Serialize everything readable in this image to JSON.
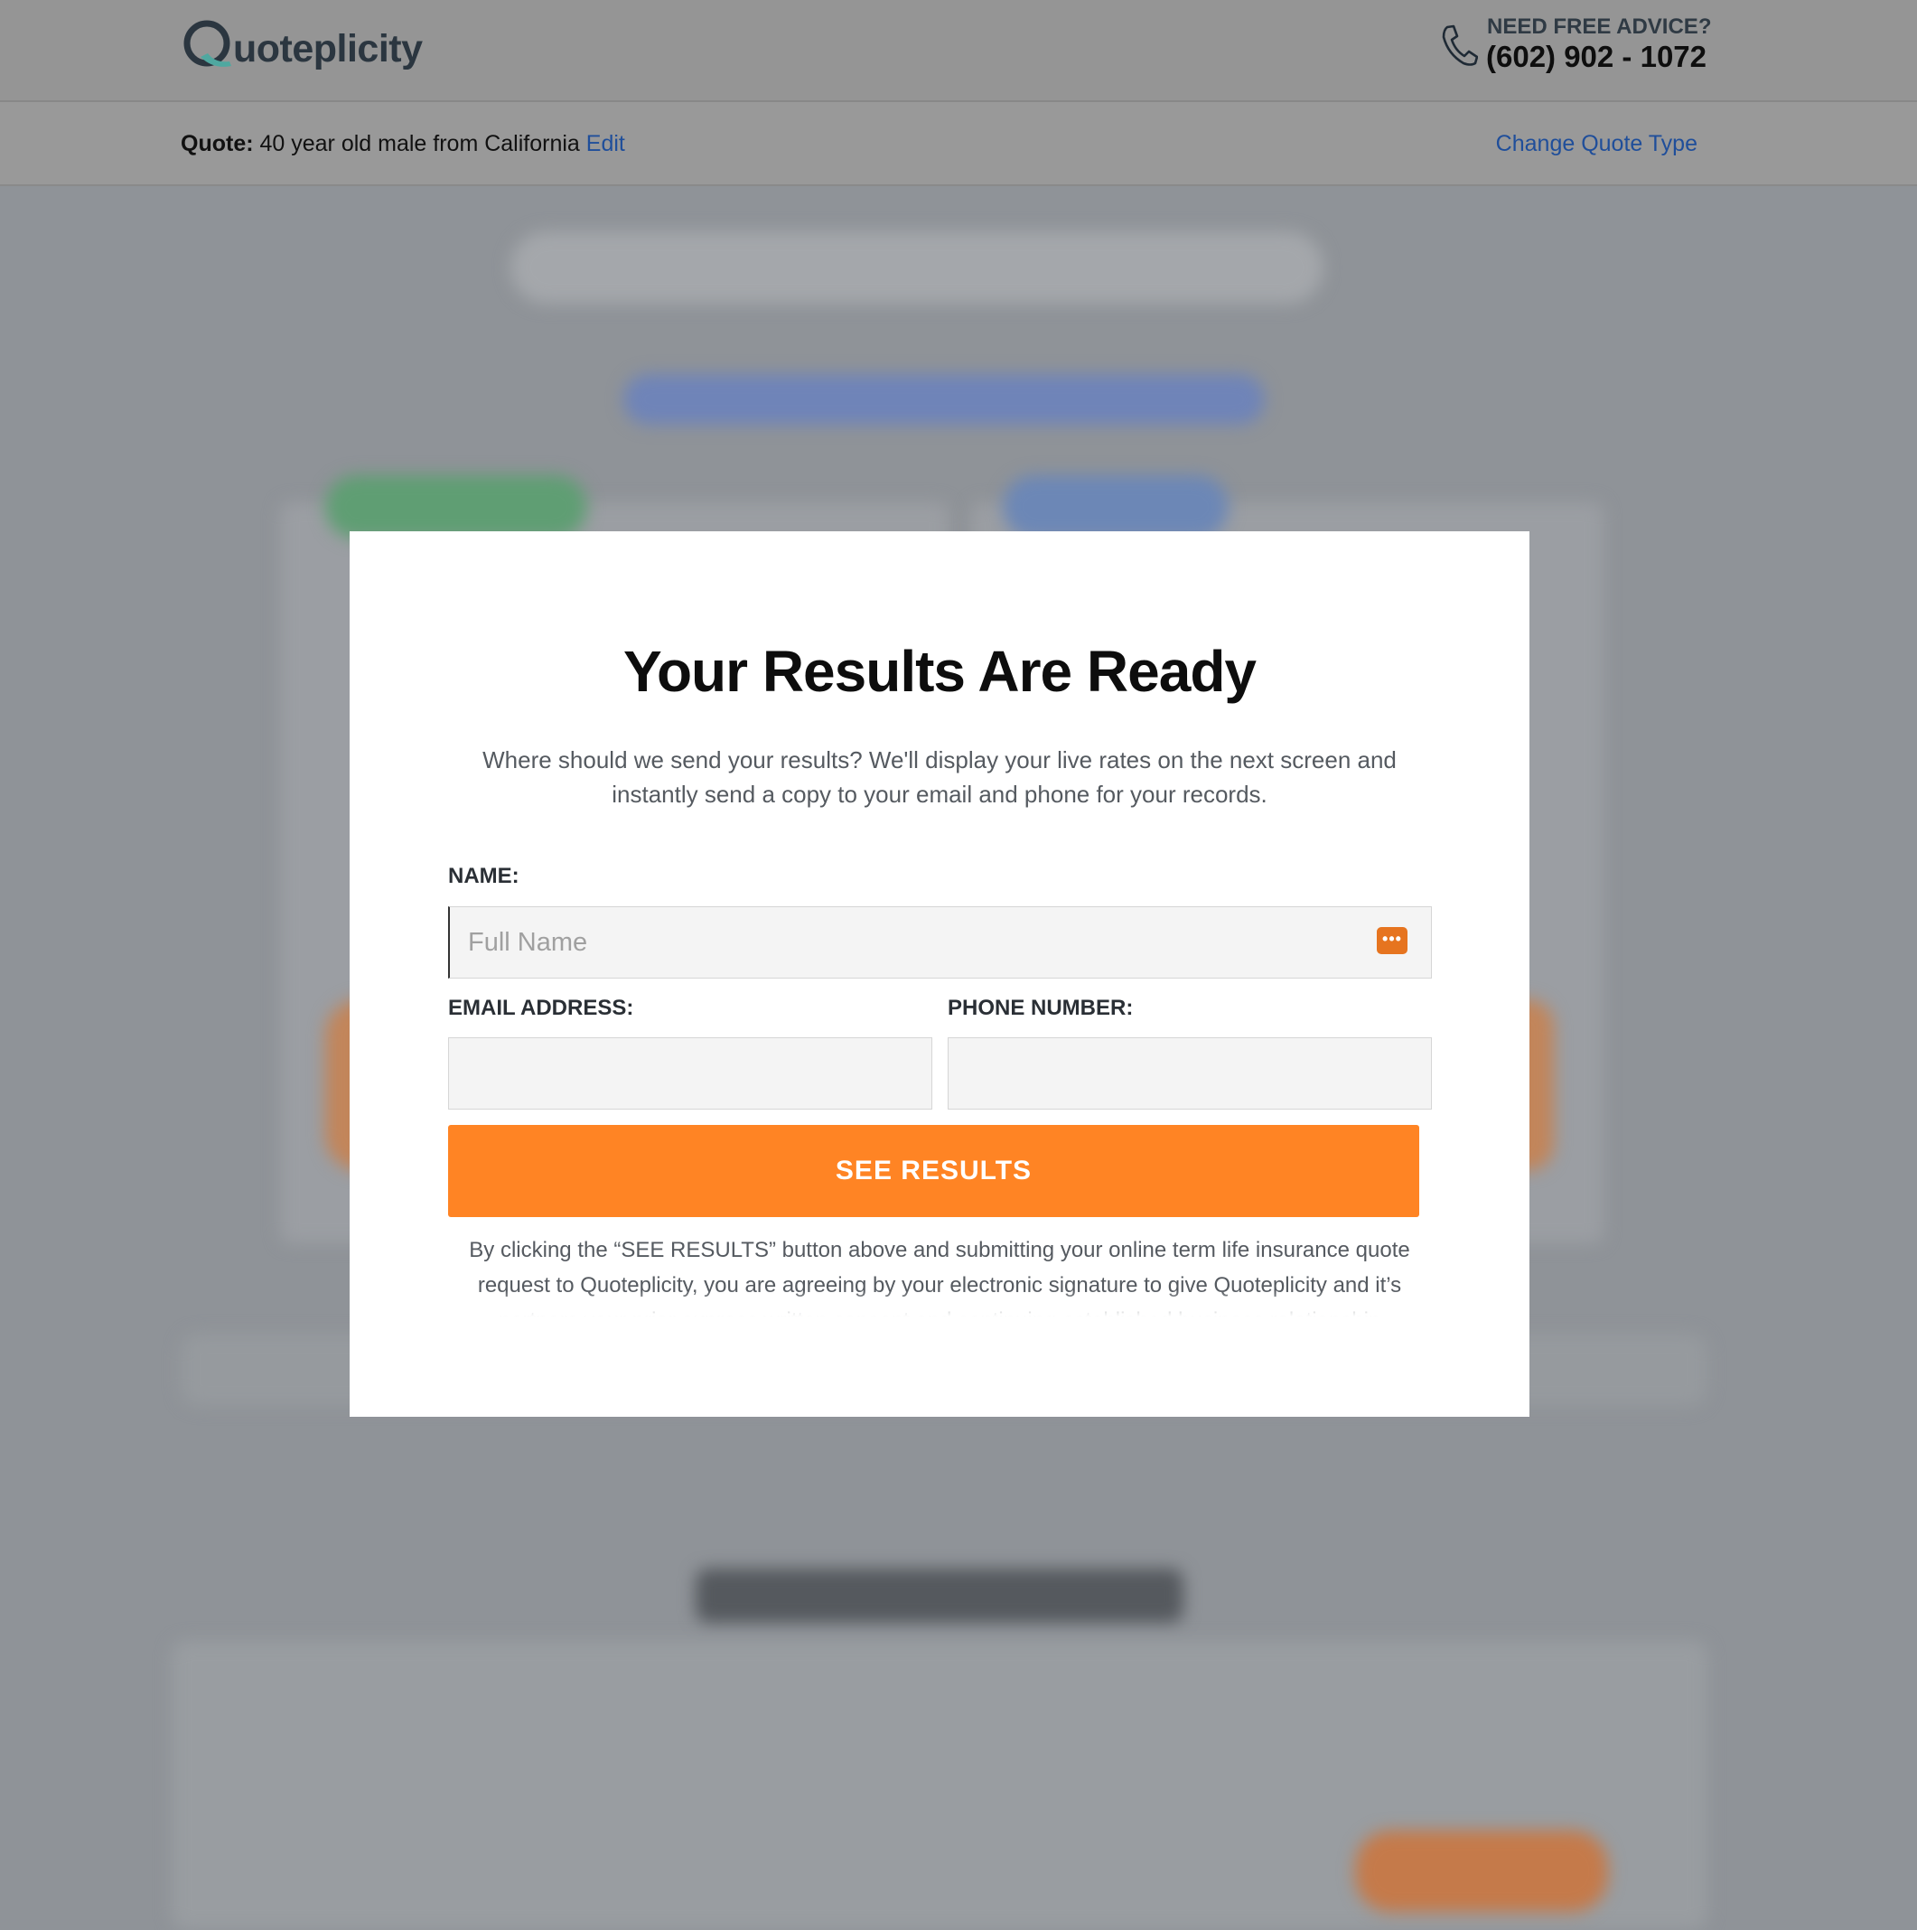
{
  "header": {
    "logo_letter": "Q",
    "logo_text": "uoteplicity",
    "advice_label": "NEED FREE ADVICE?",
    "phone_number": "(602) 902 - 1072"
  },
  "quote_bar": {
    "label": "Quote:",
    "description": "40 year old male from California",
    "edit_link": "Edit",
    "change_type_link": "Change Quote Type"
  },
  "modal": {
    "title": "Your Results Are Ready",
    "subtitle": "Where should we send your results? We'll display your live rates on the next screen and instantly send a copy to your email and phone for your records.",
    "name_label": "NAME:",
    "name_placeholder": "Full Name",
    "email_label": "EMAIL ADDRESS:",
    "email_value": "",
    "phone_label": "PHONE NUMBER:",
    "phone_value": "",
    "submit_label": "SEE RESULTS",
    "disclaimer": "By clicking the “SEE RESULTS” button above and submitting your online term life insurance quote request to Quoteplicity, you are agreeing by your electronic signature to give Quoteplicity and it’s partners your prior express written consent and continuing established business relationship"
  },
  "colors": {
    "accent_orange": "#ff8424",
    "link_blue": "#1f4e9a",
    "overlay_gray": "#8f9398"
  }
}
